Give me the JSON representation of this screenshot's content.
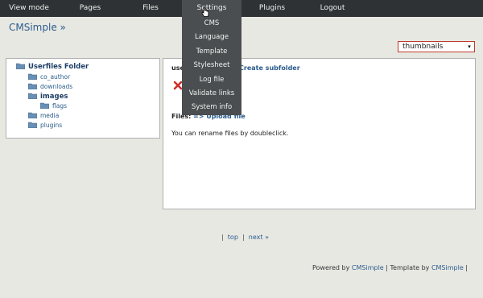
{
  "nav": {
    "items": [
      {
        "label": "View mode"
      },
      {
        "label": "Pages"
      },
      {
        "label": "Files"
      },
      {
        "label": "Settings"
      },
      {
        "label": "Plugins"
      },
      {
        "label": "Logout"
      }
    ],
    "settings_menu": [
      {
        "label": "CMS"
      },
      {
        "label": "Language"
      },
      {
        "label": "Template"
      },
      {
        "label": "Stylesheet"
      },
      {
        "label": "Log file"
      },
      {
        "label": "Validate links"
      },
      {
        "label": "System info"
      }
    ]
  },
  "site_title": "CMSimple »",
  "view_select": {
    "value": "thumbnails"
  },
  "folders": {
    "root": "Userfiles Folder",
    "items": [
      {
        "label": "co_author"
      },
      {
        "label": "downloads"
      },
      {
        "label": "images"
      },
      {
        "label": "flags"
      },
      {
        "label": "media"
      },
      {
        "label": "plugins"
      }
    ]
  },
  "main": {
    "folder_prefix": "use",
    "create_subfolder": "Create subfolder",
    "files_label": "Files:",
    "upload_file": "=> Upload file",
    "rename_hint": "You can rename files by doubleclick."
  },
  "pager": {
    "sep": "|",
    "top": "top",
    "next": "next »"
  },
  "footer": {
    "powered_by": "Powered by",
    "cms_link": "CMSimple",
    "template_by": "| Template by",
    "template_link": "CMSimple",
    "end": "|"
  },
  "colors": {
    "topbar": "#2f3234",
    "dropdown": "#4a4e50",
    "link": "#2a5c8c",
    "background": "#e8e8e3"
  }
}
